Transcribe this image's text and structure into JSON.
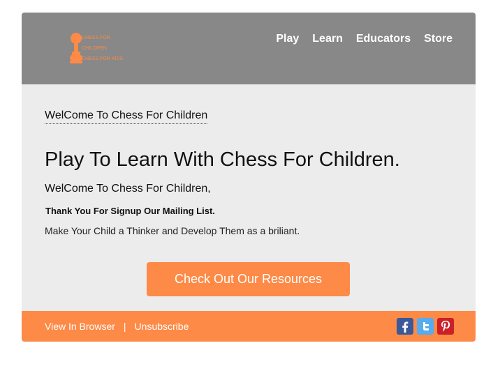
{
  "brand": {
    "logo_text": [
      "CHESS FOR",
      "CHILDREN",
      "CHESS FOR KIDS"
    ],
    "accent_color": "#fd8a47",
    "header_color": "#888888"
  },
  "nav": {
    "items": [
      {
        "label": "Play"
      },
      {
        "label": "Learn"
      },
      {
        "label": "Educators"
      },
      {
        "label": "Store"
      }
    ]
  },
  "main": {
    "welcome_tag": "WelCome To Chess For Children",
    "headline": "Play To Learn With Chess For Children.",
    "greeting": "WelCome To Chess For Children,",
    "thanks": "Thank You For Signup Our Mailing List.",
    "tagline": "Make Your Child a Thinker and Develop Them as a briliant.",
    "cta_label": "Check Out Our Resources"
  },
  "footer": {
    "view_in_browser": "View In Browser",
    "separator": "|",
    "unsubscribe": "Unsubscribe",
    "social": [
      {
        "icon": "facebook-icon",
        "color": "#3b5998"
      },
      {
        "icon": "twitter-icon",
        "color": "#55acee"
      },
      {
        "icon": "pinterest-icon",
        "color": "#cb2027"
      }
    ]
  }
}
